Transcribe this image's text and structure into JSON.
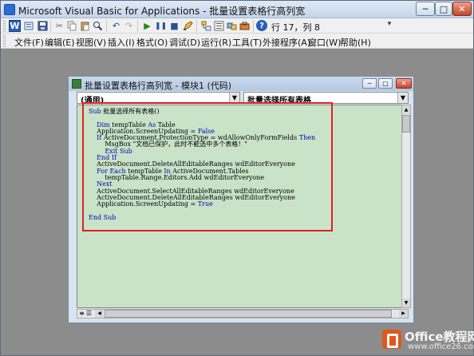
{
  "window": {
    "title": "Microsoft Visual Basic for Applications - 批量设置表格行高列宽",
    "min_glyph": "─",
    "max_glyph": "□",
    "close_glyph": "✕"
  },
  "toolbar": {
    "position_readout": "行 17，列 8",
    "icons": [
      "word-icon",
      "insert-module-icon",
      "save-icon",
      "cut-icon",
      "copy-icon",
      "paste-icon",
      "find-icon",
      "undo-icon",
      "redo-icon",
      "run-icon",
      "break-icon",
      "reset-icon",
      "design-mode-icon",
      "project-explorer-icon",
      "properties-icon",
      "object-browser-icon",
      "toolbox-icon",
      "help-icon"
    ]
  },
  "menu": {
    "items": [
      "文件(F)",
      "编辑(E)",
      "视图(V)",
      "插入(I)",
      "格式(O)",
      "调试(D)",
      "运行(R)",
      "工具(T)",
      "外接程序(A)",
      "窗口(W)",
      "帮助(H)"
    ]
  },
  "code_window": {
    "title": "批量设置表格行高列宽 - 模块1 (代码)",
    "object_combo": "(通用)",
    "procedure_combo": "批量选择所有表格",
    "code_lines": [
      [
        {
          "t": "Sub",
          "k": 1
        },
        {
          "t": " 批量选择所有表格()",
          "k": 0
        }
      ],
      [],
      [
        {
          "t": "    ",
          "k": 0
        },
        {
          "t": "Dim",
          "k": 1
        },
        {
          "t": " tempTable ",
          "k": 0
        },
        {
          "t": "As",
          "k": 1
        },
        {
          "t": " Table",
          "k": 0
        }
      ],
      [
        {
          "t": "    Application.ScreenUpdating = ",
          "k": 0
        },
        {
          "t": "False",
          "k": 1
        }
      ],
      [
        {
          "t": "    ",
          "k": 0
        },
        {
          "t": "If",
          "k": 1
        },
        {
          "t": " ActiveDocument.ProtectionType = wdAllowOnlyFormFields ",
          "k": 0
        },
        {
          "t": "Then",
          "k": 1
        }
      ],
      [
        {
          "t": "        MsgBox \"文档已保护，此时不能选中多个表格！\"",
          "k": 0
        }
      ],
      [
        {
          "t": "        ",
          "k": 0
        },
        {
          "t": "Exit Sub",
          "k": 1
        }
      ],
      [
        {
          "t": "    ",
          "k": 0
        },
        {
          "t": "End If",
          "k": 1
        }
      ],
      [
        {
          "t": "    ActiveDocument.DeleteAllEditableRanges wdEditorEveryone",
          "k": 0
        }
      ],
      [
        {
          "t": "    ",
          "k": 0
        },
        {
          "t": "For Each",
          "k": 1
        },
        {
          "t": " tempTable ",
          "k": 0
        },
        {
          "t": "In",
          "k": 1
        },
        {
          "t": " ActiveDocument.Tables",
          "k": 0
        }
      ],
      [
        {
          "t": "        tempTable.Range.Editors.Add wdEditorEveryone",
          "k": 0
        }
      ],
      [
        {
          "t": "    ",
          "k": 0
        },
        {
          "t": "Next",
          "k": 1
        }
      ],
      [
        {
          "t": "    ActiveDocument.SelectAllEditableRanges wdEditorEveryone",
          "k": 0
        }
      ],
      [
        {
          "t": "    ActiveDocument.DeleteAllEditableRanges wdEditorEveryone",
          "k": 0
        }
      ],
      [
        {
          "t": "    Application.ScreenUpdating = ",
          "k": 0
        },
        {
          "t": "True",
          "k": 1
        }
      ],
      [],
      [
        {
          "t": "End Sub",
          "k": 1
        }
      ]
    ]
  },
  "colors": {
    "keyword": "#0000b0",
    "editor_bg": "#c8e3c8",
    "highlight_box": "#e02020",
    "watermark_logo": "#e3561b"
  },
  "watermark": {
    "title": "Office教程网",
    "url": "www.office26.com"
  }
}
